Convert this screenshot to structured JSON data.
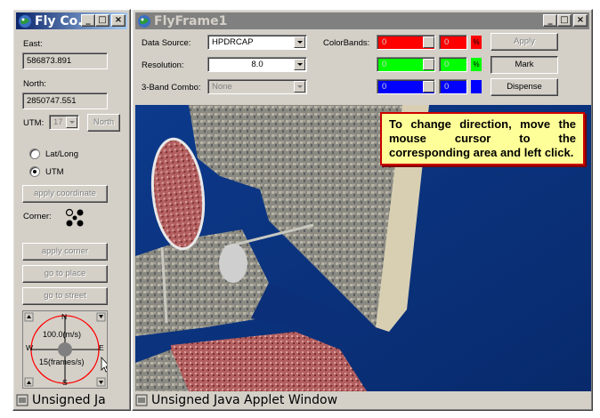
{
  "left_window": {
    "title": "Fly Co...",
    "east_label": "East:",
    "east_value": "586873.891",
    "north_label": "North:",
    "north_value": "2850747.551",
    "utm_label": "UTM:",
    "utm_zone": "17",
    "north_button": "North",
    "latlong_label": "Lat/Long",
    "utm_radio_label": "UTM",
    "selected_coord_mode": "UTM",
    "apply_coordinate": "apply coordinate",
    "corner_label": "Corner:",
    "apply_corner": "apply corner",
    "go_to_place": "go to place",
    "go_to_street": "go to street",
    "compass": {
      "n": "N",
      "s": "S",
      "e": "E",
      "w": "W",
      "speed": "100.0(m/s)",
      "rate": "15(frames/s)"
    },
    "status_text": "Unsigned Ja"
  },
  "main_window": {
    "title": "FlyFrame1",
    "data_source_label": "Data Source:",
    "data_source_value": "HPDRCAP",
    "resolution_label": "Resolution:",
    "resolution_value": "8.0",
    "combo_label": "3-Band Combo:",
    "combo_value": "None",
    "colorbands_label": "ColorBands:",
    "bands": [
      {
        "value": "0",
        "value2": "0",
        "swatch_text": "%",
        "color": "#ff0000"
      },
      {
        "value": "0",
        "value2": "0",
        "swatch_text": "%",
        "color": "#00ff00"
      },
      {
        "value": "0",
        "value2": "0",
        "swatch_text": "%",
        "color": "#0000ff"
      }
    ],
    "apply_button": "Apply",
    "mark_button": "Mark",
    "dispense_button": "Dispense",
    "callout_text": "To change direction, move the mouse cursor to the corresponding area and left click.",
    "status_text": "Unsigned Java Applet Window"
  },
  "colors": {
    "title_active": "#0a246a",
    "title_inactive": "#808080",
    "window_face": "#d4d0c8",
    "callout_bg": "#ffff99",
    "callout_border": "#cc0000",
    "compass_ring": "#ff0000"
  }
}
